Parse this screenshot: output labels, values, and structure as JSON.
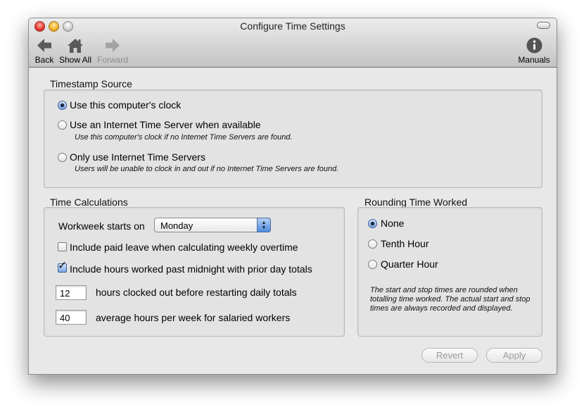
{
  "window": {
    "title": "Configure Time Settings"
  },
  "toolbar": {
    "back_label": "Back",
    "show_all_label": "Show All",
    "forward_label": "Forward",
    "manuals_label": "Manuals"
  },
  "timestamp_source": {
    "title": "Timestamp Source",
    "options": [
      {
        "label": "Use this computer's clock",
        "note": "",
        "selected": true
      },
      {
        "label": "Use an Internet Time Server when available",
        "note": "Use this computer's clock if no Internet Time Servers are found.",
        "selected": false
      },
      {
        "label": "Only use Internet Time Servers",
        "note": "Users will be unable to clock in and out if no Internet Time Servers are found.",
        "selected": false
      }
    ]
  },
  "time_calculations": {
    "title": "Time Calculations",
    "workweek_label": "Workweek starts on",
    "workweek_value": "Monday",
    "paid_leave": {
      "label": "Include paid leave when calculating weekly overtime",
      "checked": false
    },
    "past_midnight": {
      "label": "Include hours worked past midnight with prior day totals",
      "checked": true
    },
    "clocked_out": {
      "value": "12",
      "label": "hours clocked out before restarting daily totals"
    },
    "salaried": {
      "value": "40",
      "label": "average hours per week for salaried workers"
    }
  },
  "rounding": {
    "title": "Rounding Time Worked",
    "options": [
      {
        "label": "None",
        "selected": true
      },
      {
        "label": "Tenth Hour",
        "selected": false
      },
      {
        "label": "Quarter Hour",
        "selected": false
      }
    ],
    "note": "The start and stop times are rounded when totalling time worked. The actual start and stop times are always recorded and displayed."
  },
  "buttons": {
    "revert_label": "Revert",
    "apply_label": "Apply"
  },
  "colors": {
    "accent": "#4e8ae0",
    "window_bg": "#e8e8e8",
    "disabled_text": "#9a9a9a"
  },
  "icons": [
    "back-arrow-icon",
    "home-icon",
    "forward-arrow-icon",
    "info-icon"
  ]
}
